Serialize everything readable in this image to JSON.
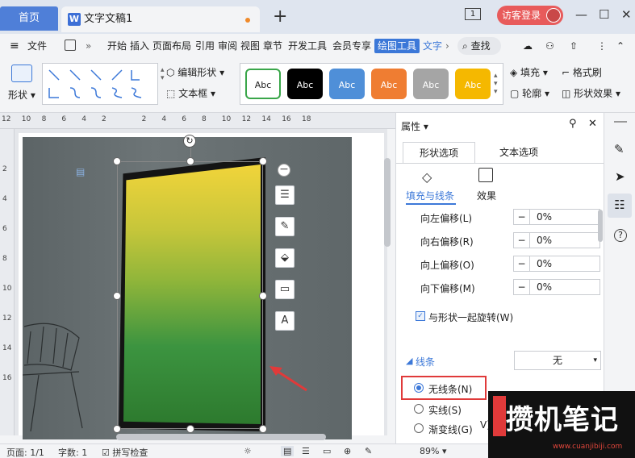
{
  "titlebar": {
    "home": "首页",
    "doc_title": "文字文稿1",
    "new_tab": "+",
    "login": "访客登录",
    "badge": "1",
    "minimize": "—",
    "maximize": "☐",
    "close": "✕"
  },
  "menubar": {
    "file": "文件",
    "items": [
      "开始",
      "插入",
      "页面布局",
      "引用",
      "审阅",
      "视图",
      "章节",
      "开发工具",
      "会员专享",
      "绘图工具",
      "文字"
    ],
    "active": "绘图工具",
    "search": "查找"
  },
  "ribbon": {
    "shape_label": "形状",
    "edit_shape": "编辑形状",
    "text_box": "文本框",
    "styles": [
      {
        "label": "Abc",
        "bg": "#ffffff",
        "fg": "#222222",
        "border": "#3aa64a"
      },
      {
        "label": "Abc",
        "bg": "#000000",
        "fg": "#ffffff",
        "border": "#000000"
      },
      {
        "label": "Abc",
        "bg": "#4f8fd8",
        "fg": "#ffffff",
        "border": "#4f8fd8"
      },
      {
        "label": "Abc",
        "bg": "#ef7d32",
        "fg": "#ffffff",
        "border": "#ef7d32"
      },
      {
        "label": "Abc",
        "bg": "#a5a5a5",
        "fg": "#ffffff",
        "border": "#a5a5a5"
      },
      {
        "label": "Abc",
        "bg": "#f5b800",
        "fg": "#ffffff",
        "border": "#f5b800"
      }
    ],
    "fill": "填充",
    "outline": "轮廓",
    "format_brush": "格式刷",
    "shape_effect": "形状效果"
  },
  "ruler": {
    "numbers": [
      "12",
      "10",
      "8",
      "6",
      "4",
      "2",
      "",
      "2",
      "4",
      "6",
      "8",
      "10",
      "12",
      "14",
      "16",
      "18"
    ],
    "vnumbers": [
      "",
      "2",
      "4",
      "6",
      "8",
      "10",
      "12",
      "14",
      "16"
    ]
  },
  "panel": {
    "title": "属性",
    "tab_shape": "形状选项",
    "tab_text": "文本选项",
    "sub_fill": "填充与线条",
    "sub_effect": "效果",
    "offsets": [
      {
        "label": "向左偏移(L)",
        "value": "0%"
      },
      {
        "label": "向右偏移(R)",
        "value": "0%"
      },
      {
        "label": "向上偏移(O)",
        "value": "0%"
      },
      {
        "label": "向下偏移(M)",
        "value": "0%"
      }
    ],
    "rotate_with_shape": "与形状一起旋转(W)",
    "line_section": "线条",
    "line_value": "无",
    "radio_none": "无线条(N)",
    "radio_solid": "实线(S)",
    "radio_gradient": "渐变线(G)",
    "cut_v": "V)"
  },
  "status": {
    "page": "页面: 1/1",
    "words": "字数: 1",
    "spell": "拼写检查",
    "zoom": "89%"
  },
  "watermark": {
    "big": "攒机笔记",
    "small": "www.cuanjibiji.com"
  },
  "colors": {
    "accent": "#3c78d8",
    "highlight": "#e03a3a",
    "arrow": "#e03a3a"
  }
}
